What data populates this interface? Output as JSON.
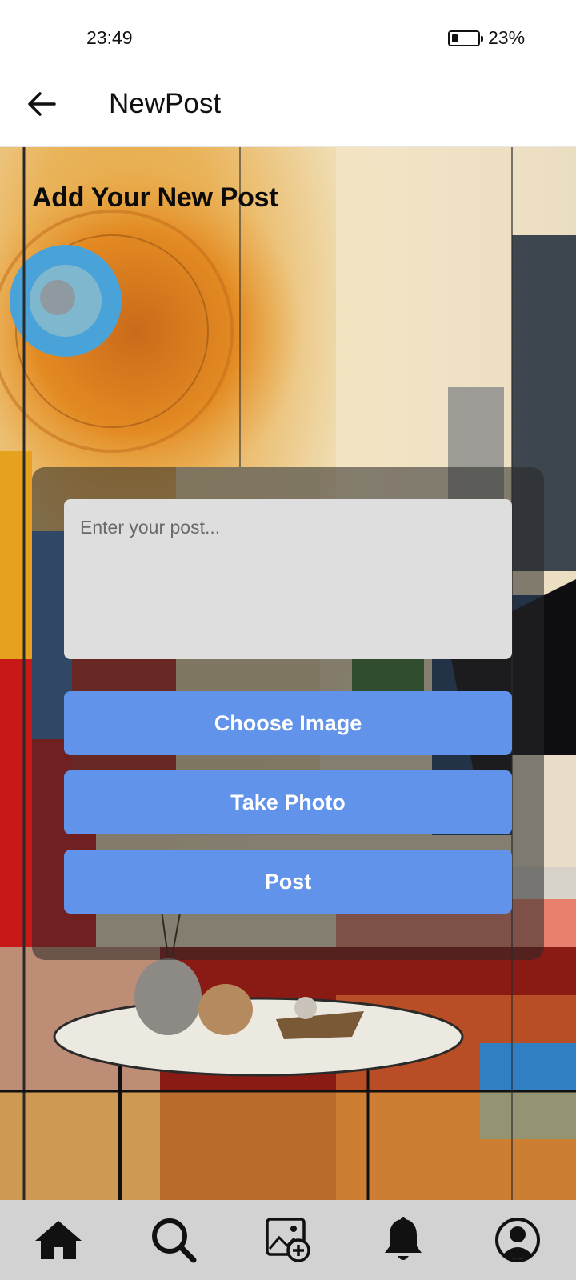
{
  "status_bar": {
    "time": "23:49",
    "battery_text": "23%",
    "battery_level": 0.23
  },
  "app_bar": {
    "title": "NewPost",
    "back_icon": "arrow-left-icon"
  },
  "page": {
    "heading": "Add Your New Post"
  },
  "form": {
    "post_input": {
      "value": "",
      "placeholder": "Enter your post..."
    },
    "choose_image_label": "Choose Image",
    "take_photo_label": "Take Photo",
    "post_label": "Post",
    "button_color": "#6193eb"
  },
  "bottom_nav": {
    "items": [
      {
        "icon": "home-icon"
      },
      {
        "icon": "search-icon"
      },
      {
        "icon": "add-image-icon"
      },
      {
        "icon": "bell-icon"
      },
      {
        "icon": "profile-icon"
      }
    ],
    "background": "#d2d2d2"
  }
}
